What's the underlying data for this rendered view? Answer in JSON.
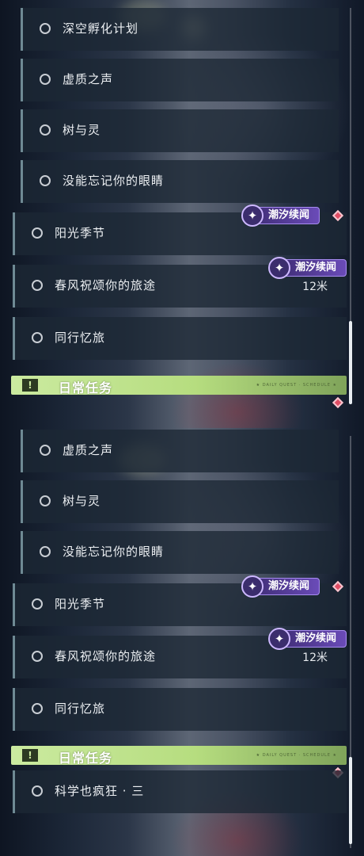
{
  "quests_top": [
    {
      "title": "深空孵化计划"
    },
    {
      "title": "虚质之声"
    },
    {
      "title": "树与灵"
    },
    {
      "title": "没能忘记你的眼睛"
    },
    {
      "title": "阳光季节"
    },
    {
      "title": "春风祝颂你的旅途",
      "distance": "12米"
    },
    {
      "title": "同行忆旅"
    }
  ],
  "quests_bottom": [
    {
      "title": "虚质之声"
    },
    {
      "title": "树与灵"
    },
    {
      "title": "没能忘记你的眼睛"
    },
    {
      "title": "阳光季节"
    },
    {
      "title": "春风祝颂你的旅途",
      "distance": "12米"
    },
    {
      "title": "同行忆旅"
    },
    {
      "title": "科学也疯狂 · 三"
    }
  ],
  "badge_label": "潮汐续闻",
  "section": {
    "title": "日常任务",
    "icon": "!",
    "tag": "★ DAILY QUEST · SCHEDULE ★"
  },
  "icons": {
    "quest_status": "circle-outline-icon",
    "badge": "tide-swirl-icon",
    "tracker": "diamond-marker-icon",
    "section": "exclamation-icon"
  },
  "colors": {
    "badge": "#6a4bb8",
    "section": "#b6dd7f",
    "marker": "#e04d64"
  }
}
